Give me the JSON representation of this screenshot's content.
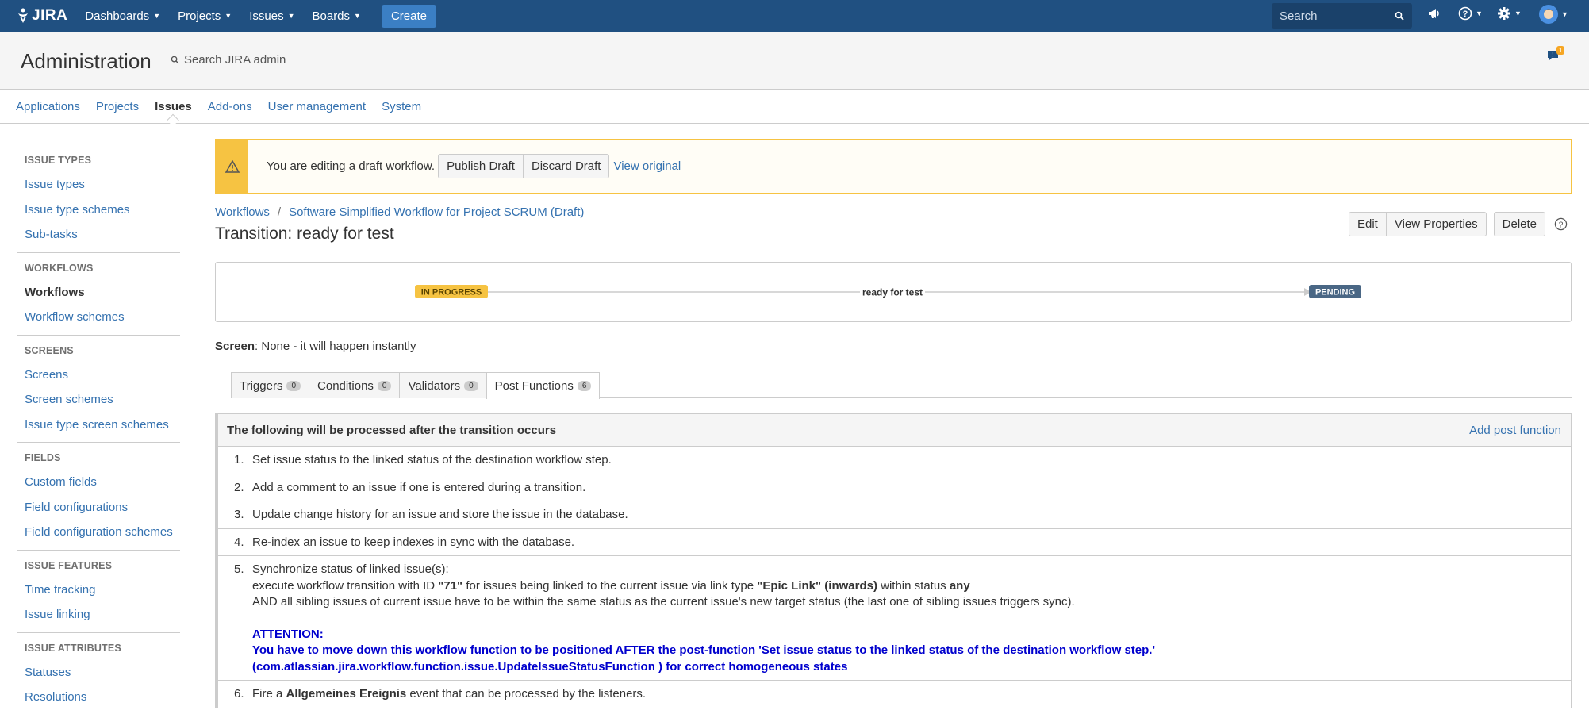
{
  "topnav": {
    "logo": "JIRA",
    "items": [
      {
        "label": "Dashboards"
      },
      {
        "label": "Projects"
      },
      {
        "label": "Issues"
      },
      {
        "label": "Boards"
      }
    ],
    "create_label": "Create",
    "search_placeholder": "Search"
  },
  "admin": {
    "title": "Administration",
    "search_placeholder": "Search JIRA admin",
    "notification_count": "1",
    "tabs": [
      {
        "label": "Applications"
      },
      {
        "label": "Projects"
      },
      {
        "label": "Issues",
        "active": true
      },
      {
        "label": "Add-ons"
      },
      {
        "label": "User management"
      },
      {
        "label": "System"
      }
    ]
  },
  "sidebar": {
    "groups": [
      {
        "heading": "Issue Types",
        "items": [
          "Issue types",
          "Issue type schemes",
          "Sub-tasks"
        ]
      },
      {
        "heading": "Workflows",
        "items": [
          "Workflows",
          "Workflow schemes"
        ],
        "active": "Workflows"
      },
      {
        "heading": "Screens",
        "items": [
          "Screens",
          "Screen schemes",
          "Issue type screen schemes"
        ]
      },
      {
        "heading": "Fields",
        "items": [
          "Custom fields",
          "Field configurations",
          "Field configuration schemes"
        ]
      },
      {
        "heading": "Issue Features",
        "items": [
          "Time tracking",
          "Issue linking"
        ]
      },
      {
        "heading": "Issue Attributes",
        "items": [
          "Statuses",
          "Resolutions"
        ]
      }
    ]
  },
  "draft": {
    "text": "You are editing a draft workflow.",
    "publish": "Publish Draft",
    "discard": "Discard Draft",
    "view_original": "View original"
  },
  "breadcrumb": {
    "root": "Workflows",
    "sep": "/",
    "current": "Software Simplified Workflow for Project SCRUM (Draft)"
  },
  "transition": {
    "title": "Transition: ready for test",
    "edit": "Edit",
    "view_properties": "View Properties",
    "delete": "Delete"
  },
  "diagram": {
    "from_status": "IN PROGRESS",
    "transition_label": "ready for test",
    "to_status": "PENDING",
    "from_color": "#f6c342",
    "to_color": "#4a6785"
  },
  "screen": {
    "label": "Screen",
    "value": ": None - it will happen instantly"
  },
  "tabs": [
    {
      "label": "Triggers",
      "count": "0"
    },
    {
      "label": "Conditions",
      "count": "0"
    },
    {
      "label": "Validators",
      "count": "0"
    },
    {
      "label": "Post Functions",
      "count": "6",
      "active": true
    }
  ],
  "post_functions": {
    "header": "The following will be processed after the transition occurs",
    "add_link": "Add post function",
    "items": [
      {
        "num": "1.",
        "text": "Set issue status to the linked status of the destination workflow step."
      },
      {
        "num": "2.",
        "text": "Add a comment to an issue if one is entered during a transition."
      },
      {
        "num": "3.",
        "text": "Update change history for an issue and store the issue in the database."
      },
      {
        "num": "4.",
        "text": "Re-index an issue to keep indexes in sync with the database."
      },
      {
        "num": "5.",
        "line1": "Synchronize status of linked issue(s):",
        "line2_a": "execute workflow transition with ID ",
        "line2_id": "\"71\"",
        "line2_b": " for issues being linked to the current issue via link type ",
        "line2_type": "\"Epic Link\" (inwards)",
        "line2_c": " within status ",
        "line2_status": "any",
        "line3": "AND all sibling issues of current issue have to be within the same status as the current issue's new target status (the last one of sibling issues triggers sync).",
        "attention_title": "ATTENTION:",
        "attention_text": "You have to move down this workflow function to be positioned AFTER the post-function 'Set issue status to the linked status of the destination workflow step.' (com.atlassian.jira.workflow.function.issue.UpdateIssueStatusFunction ) for correct homogeneous states"
      },
      {
        "num": "6.",
        "text_a": "Fire a ",
        "text_bold": "Allgemeines Ereignis",
        "text_b": " event that can be processed by the listeners."
      }
    ]
  }
}
